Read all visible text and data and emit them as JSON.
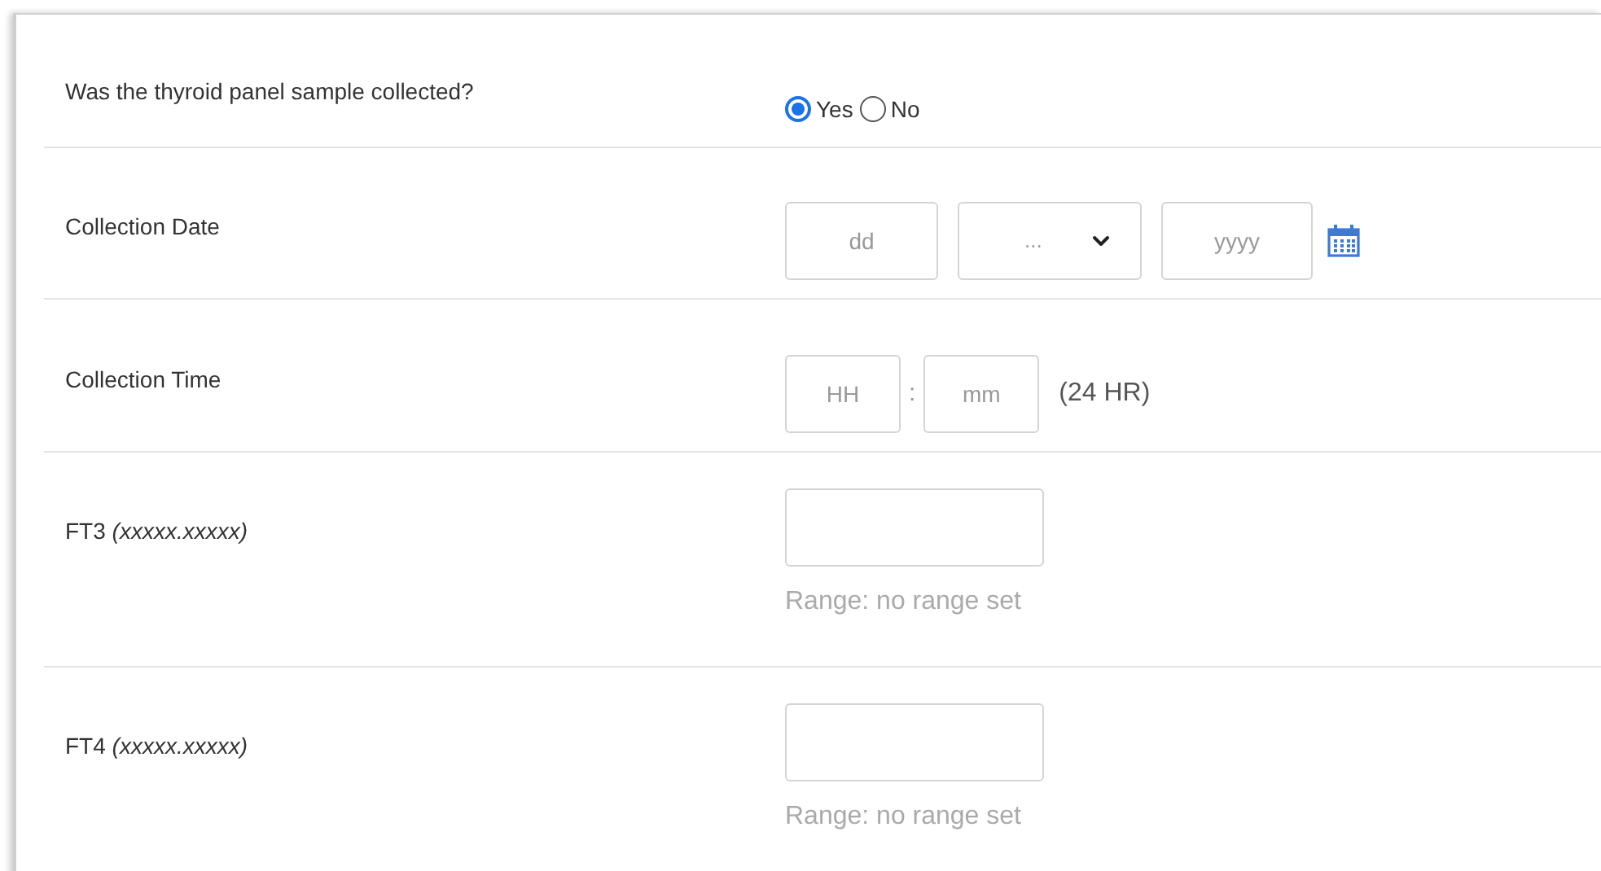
{
  "rows": [
    {
      "kind": "radio",
      "label": "Was the thyroid panel sample collected?",
      "options": [
        {
          "label": "Yes",
          "selected": true
        },
        {
          "label": "No",
          "selected": false
        }
      ]
    },
    {
      "kind": "date",
      "label": "Collection Date",
      "day_placeholder": "dd",
      "month_value": "...",
      "year_placeholder": "yyyy"
    },
    {
      "kind": "time",
      "label": "Collection Time",
      "hour_placeholder": "HH",
      "separator": ":",
      "minute_placeholder": "mm",
      "suffix": "(24 HR)"
    },
    {
      "kind": "number",
      "label": "FT3 *(xxxxx.xxxxx)*",
      "range": "Range: no range set"
    },
    {
      "kind": "number",
      "label": "FT4 *(xxxxx.xxxxx)*",
      "range": "Range: no range set"
    }
  ]
}
